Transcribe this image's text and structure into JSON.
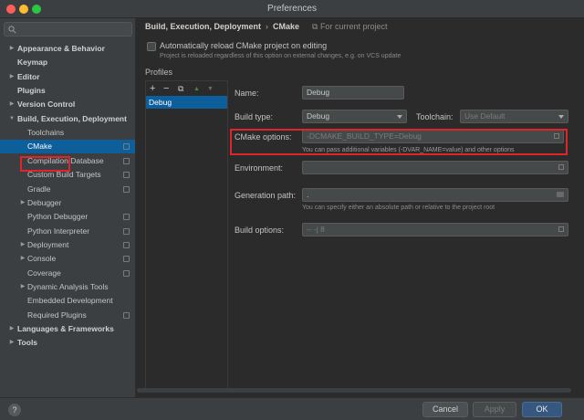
{
  "window": {
    "title": "Preferences"
  },
  "sidebar": {
    "search_placeholder": "",
    "items": [
      {
        "label": "Appearance & Behavior",
        "level": 0,
        "arrow": "collapsed",
        "bold": true
      },
      {
        "label": "Keymap",
        "level": 0,
        "arrow": "none",
        "bold": true
      },
      {
        "label": "Editor",
        "level": 0,
        "arrow": "collapsed",
        "bold": true
      },
      {
        "label": "Plugins",
        "level": 0,
        "arrow": "none",
        "bold": true
      },
      {
        "label": "Version Control",
        "level": 0,
        "arrow": "collapsed",
        "bold": true
      },
      {
        "label": "Build, Execution, Deployment",
        "level": 0,
        "arrow": "expanded",
        "bold": true
      },
      {
        "label": "Toolchains",
        "level": 1,
        "arrow": "none"
      },
      {
        "label": "CMake",
        "level": 1,
        "arrow": "none",
        "selected": true,
        "copy": true
      },
      {
        "label": "Compilation Database",
        "level": 1,
        "arrow": "none",
        "copy": true
      },
      {
        "label": "Custom Build Targets",
        "level": 1,
        "arrow": "none",
        "copy": true
      },
      {
        "label": "Gradle",
        "level": 1,
        "arrow": "none",
        "copy": true
      },
      {
        "label": "Debugger",
        "level": 1,
        "arrow": "collapsed"
      },
      {
        "label": "Python Debugger",
        "level": 1,
        "arrow": "none",
        "copy": true
      },
      {
        "label": "Python Interpreter",
        "level": 1,
        "arrow": "none",
        "copy": true
      },
      {
        "label": "Deployment",
        "level": 1,
        "arrow": "collapsed",
        "copy": true
      },
      {
        "label": "Console",
        "level": 1,
        "arrow": "collapsed",
        "copy": true
      },
      {
        "label": "Coverage",
        "level": 1,
        "arrow": "none",
        "copy": true
      },
      {
        "label": "Dynamic Analysis Tools",
        "level": 1,
        "arrow": "collapsed"
      },
      {
        "label": "Embedded Development",
        "level": 1,
        "arrow": "none"
      },
      {
        "label": "Required Plugins",
        "level": 1,
        "arrow": "none",
        "copy": true
      },
      {
        "label": "Languages & Frameworks",
        "level": 0,
        "arrow": "collapsed",
        "bold": true
      },
      {
        "label": "Tools",
        "level": 0,
        "arrow": "collapsed",
        "bold": true
      }
    ]
  },
  "main": {
    "breadcrumb": {
      "section": "Build, Execution, Deployment",
      "separator": "›",
      "page": "CMake",
      "project_note": "For current project"
    },
    "auto_reload": {
      "label": "Automatically reload CMake project on editing",
      "hint": "Project is reloaded regardless of this option on external changes, e.g. on VCS update",
      "checked": false
    },
    "profiles_label": "Profiles",
    "profile_toolbar": {
      "add": "+",
      "remove": "−",
      "copy": "⧉",
      "up": "▲",
      "down": "▼"
    },
    "profiles": [
      {
        "name": "Debug"
      }
    ],
    "form": {
      "name_label": "Name:",
      "name_value": "Debug",
      "build_type_label": "Build type:",
      "build_type_value": "Debug",
      "toolchain_label": "Toolchain:",
      "toolchain_value": "Use Default",
      "cmake_options_label": "CMake options:",
      "cmake_options_value": "-DCMAKE_BUILD_TYPE=Debug",
      "cmake_options_hint": "You can pass additional variables (-DVAR_NAME=value) and other options",
      "environment_label": "Environment:",
      "environment_value": "",
      "generation_path_label": "Generation path:",
      "generation_path_value": ".",
      "generation_path_hint": "You can specify either an absolute path or relative to the project root",
      "build_options_label": "Build options:",
      "build_options_value": "-- -j 8"
    }
  },
  "footer": {
    "help": "?",
    "cancel": "Cancel",
    "apply": "Apply",
    "ok": "OK"
  },
  "colors": {
    "selection": "#0d5f9c",
    "highlight_box": "#e0242c",
    "primary_button": "#365880"
  }
}
